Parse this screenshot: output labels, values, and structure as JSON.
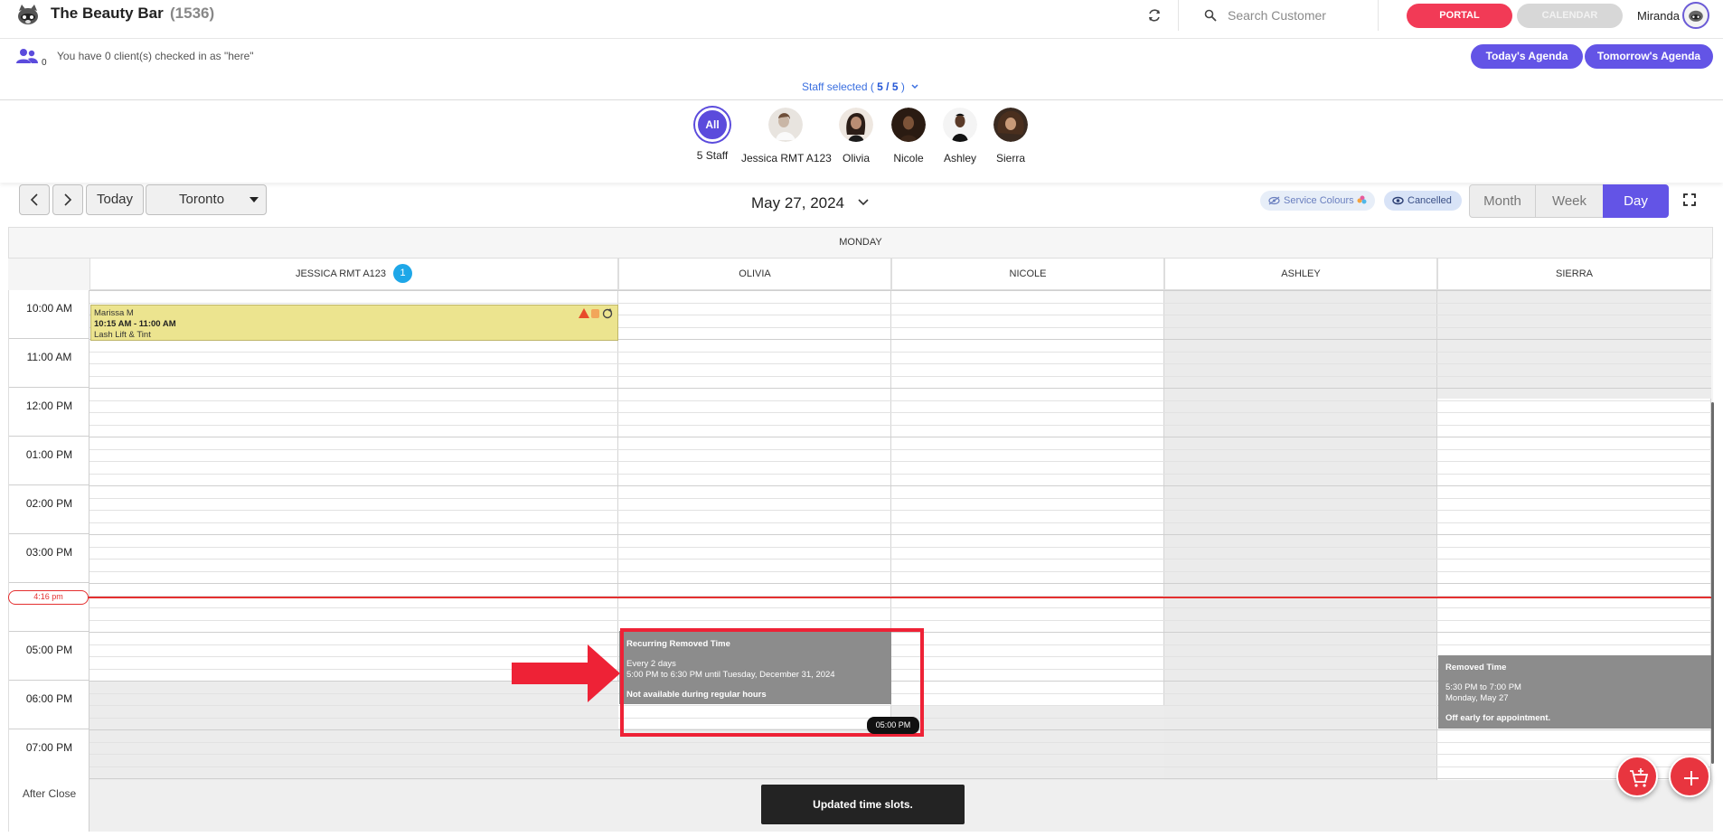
{
  "header": {
    "brand_name": "The Beauty Bar",
    "brand_count": "(1536)",
    "search_placeholder": "Search Customer",
    "portal_label": "PORTAL",
    "calendar_label": "CALENDAR",
    "user_name": "Miranda"
  },
  "checkin": {
    "count": "0",
    "text": "You have 0 client(s) checked in as \"here\"",
    "todays_agenda": "Today's Agenda",
    "tomorrows_agenda": "Tomorrow's Agenda",
    "staff_selected_prefix": "Staff selected ( ",
    "staff_selected_value": "5 / 5",
    "staff_selected_suffix": " )"
  },
  "staff": [
    {
      "name": "5 Staff",
      "initials": "All"
    },
    {
      "name": "Jessica RMT A123"
    },
    {
      "name": "Olivia"
    },
    {
      "name": "Nicole"
    },
    {
      "name": "Ashley"
    },
    {
      "name": "Sierra"
    }
  ],
  "toolbar": {
    "today_label": "Today",
    "location": "Toronto",
    "date": "May 27, 2024",
    "service_colours": "Service Colours",
    "cancelled": "Cancelled",
    "views": [
      "Month",
      "Week",
      "Day"
    ],
    "active_view": "Day"
  },
  "calendar": {
    "day": "MONDAY",
    "columns": [
      {
        "name": "JESSICA RMT A123",
        "badge": "1"
      },
      {
        "name": "OLIVIA"
      },
      {
        "name": "NICOLE"
      },
      {
        "name": "ASHLEY"
      },
      {
        "name": "SIERRA"
      }
    ],
    "times": [
      "10:00 AM",
      "11:00 AM",
      "12:00 PM",
      "01:00 PM",
      "02:00 PM",
      "03:00 PM",
      "04:00 PM",
      "05:00 PM",
      "06:00 PM",
      "07:00 PM"
    ],
    "after_close": "After Close",
    "now_label": "4:16 pm",
    "appointment": {
      "client": "Marissa M",
      "time": "10:15 AM - 11:00 AM",
      "service": "Lash Lift & Tint"
    },
    "removed_olivia": {
      "title": "Recurring Removed Time",
      "repeat": "Every 2 days",
      "range": "5:00 PM to 6:30 PM until Tuesday, December 31, 2024",
      "note": "Not available during regular hours",
      "chip": "05:00 PM"
    },
    "removed_sierra": {
      "title": "Removed Time",
      "range": "5:30 PM to 7:00 PM",
      "date": "Monday, May 27",
      "note": "Off early for appointment."
    }
  },
  "toast": "Updated time slots.",
  "colors": {
    "accent": "#6354e6",
    "portal": "#f23a56",
    "appointment": "#ece48f",
    "removed": "#8c8c8c",
    "now_line": "#e43030"
  }
}
